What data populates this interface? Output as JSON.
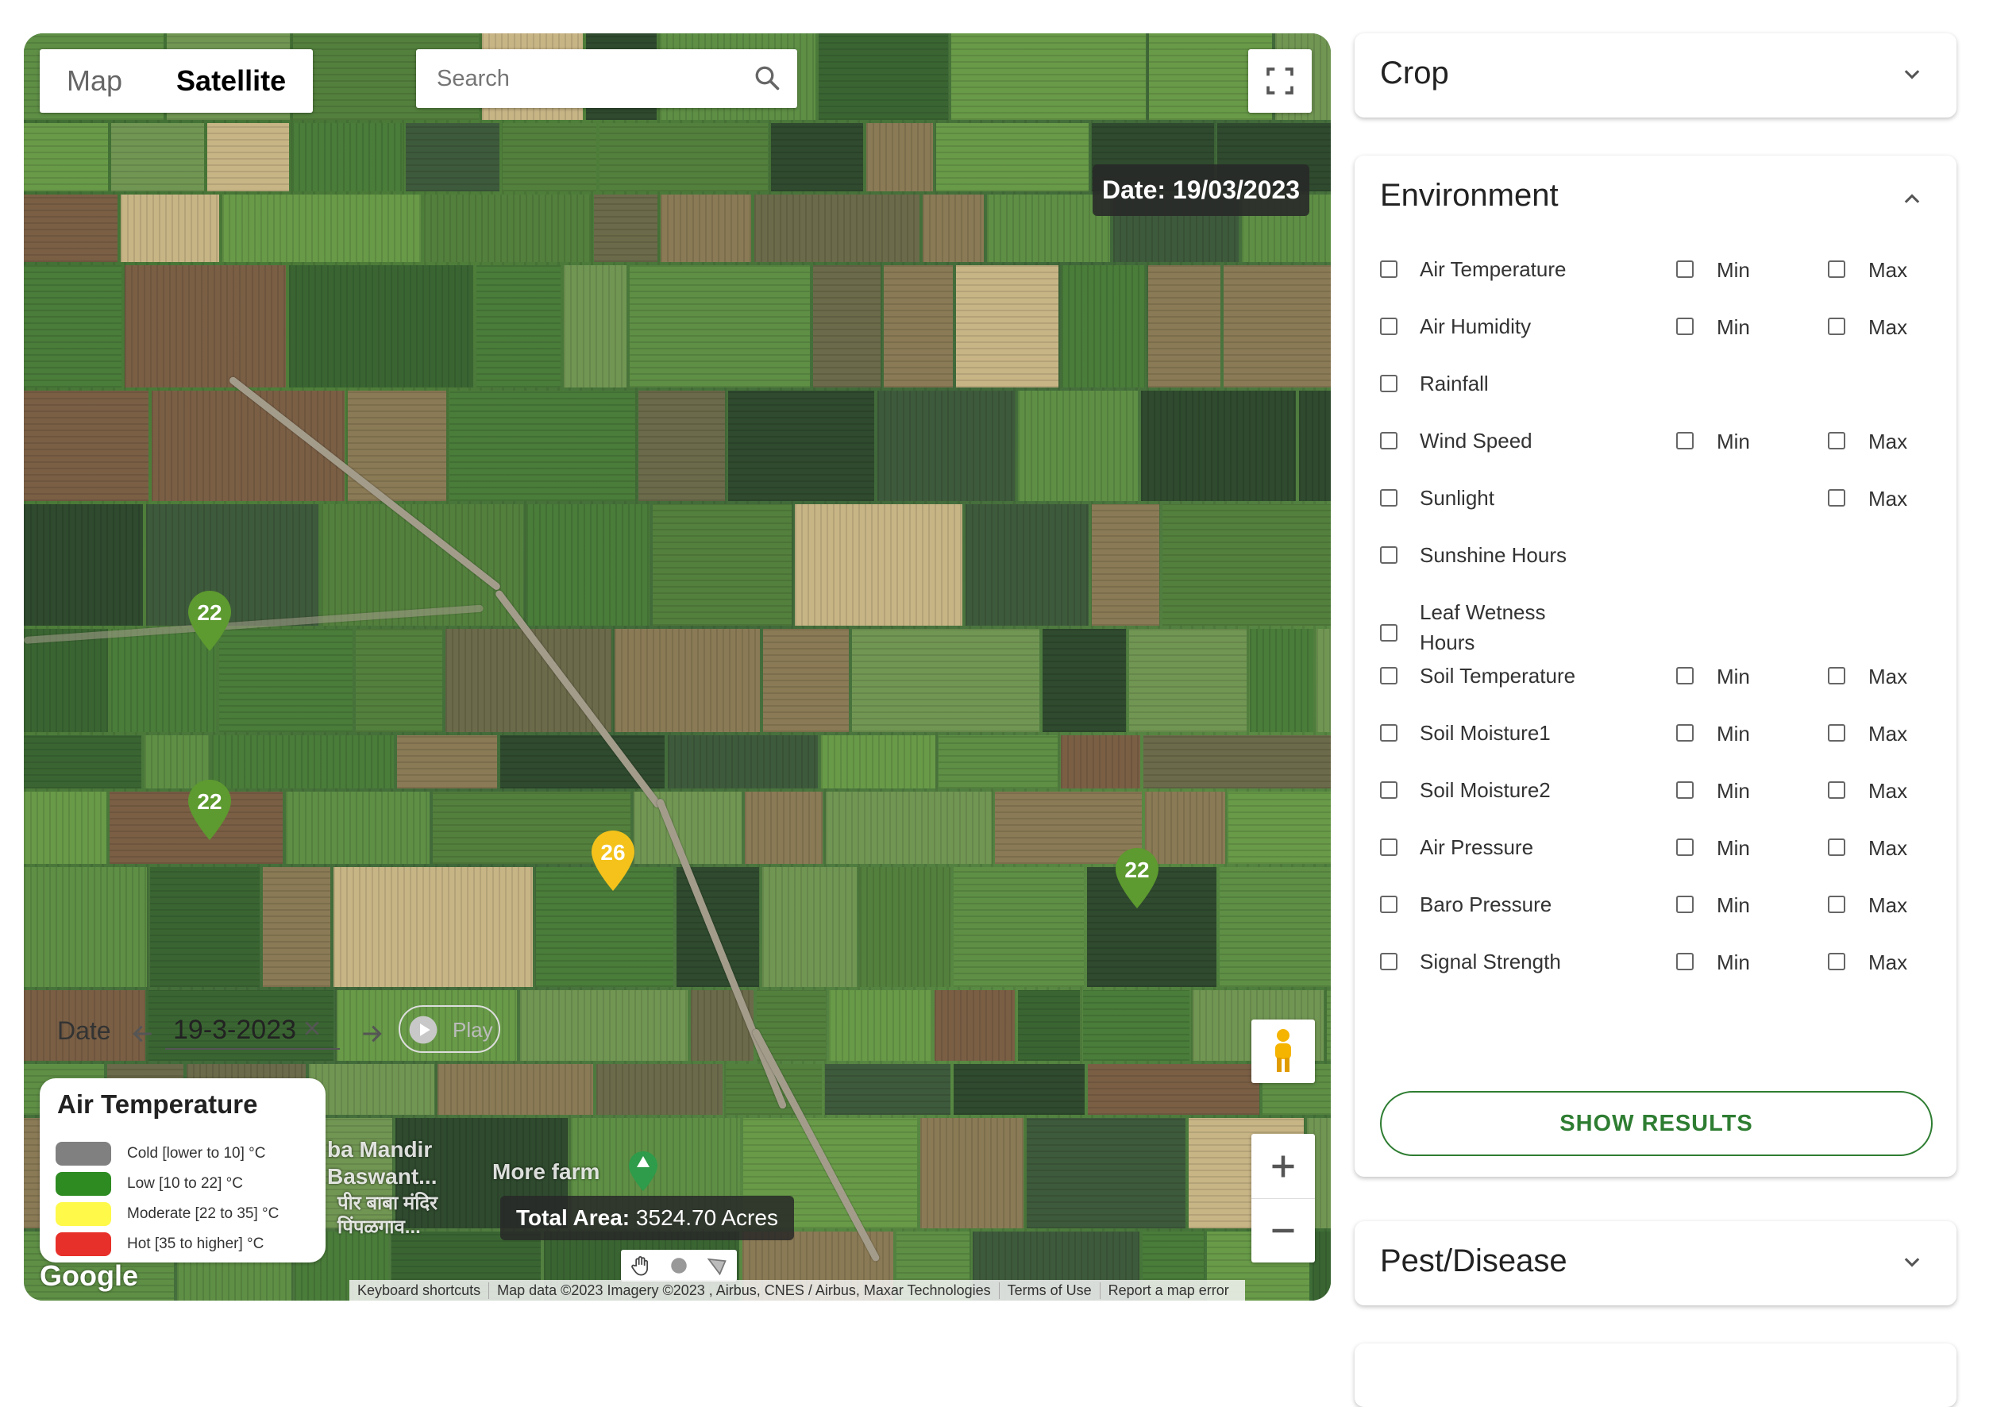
{
  "map": {
    "type_tabs": [
      "Map",
      "Satellite"
    ],
    "active_tab": "Satellite",
    "search_placeholder": "Search",
    "date_overlay": "Date: 19/03/2023",
    "markers": [
      {
        "value": "22",
        "color": "#5d9a2f"
      },
      {
        "value": "22",
        "color": "#5d9a2f"
      },
      {
        "value": "26",
        "color": "#f4c21a"
      },
      {
        "value": "22",
        "color": "#5d9a2f"
      }
    ],
    "legend": {
      "title": "Air Temperature",
      "items": [
        {
          "label": "Cold [lower to 10] °C",
          "color": "#808080"
        },
        {
          "label": "Low [10 to 22] °C",
          "color": "#2e8b22"
        },
        {
          "label": "Moderate [22 to 35] °C",
          "color": "#fff94a"
        },
        {
          "label": "Hot [35 to higher] °C",
          "color": "#e8302a"
        }
      ]
    },
    "total_area_label": "Total Area:",
    "total_area_value": "3524.70 Acres",
    "place_labels": [
      "ba Mandir",
      "Baswant...",
      "पीर बाबा मंदिर",
      "पिंपळगाव...",
      "More farm"
    ],
    "logo": "Google",
    "attribution": [
      "Keyboard shortcuts",
      "Map data ©2023 Imagery ©2023 , Airbus, CNES / Airbus, Maxar Technologies",
      "Terms of Use",
      "Report a map error"
    ]
  },
  "panel": {
    "crop": {
      "title": "Crop"
    },
    "environment": {
      "title": "Environment",
      "min_label": "Min",
      "max_label": "Max",
      "rows": [
        {
          "label": "Air Temperature",
          "min": true,
          "max": true
        },
        {
          "label": "Air Humidity",
          "min": true,
          "max": true
        },
        {
          "label": "Rainfall",
          "min": false,
          "max": false
        },
        {
          "label": "Wind Speed",
          "min": true,
          "max": true
        },
        {
          "label": "Sunlight",
          "min": false,
          "max": true
        },
        {
          "label": "Sunshine Hours",
          "min": false,
          "max": false
        },
        {
          "label": "Leaf Wetness Hours",
          "min": false,
          "max": false
        },
        {
          "label": "Soil Temperature",
          "min": true,
          "max": true
        },
        {
          "label": "Soil Moisture1",
          "min": true,
          "max": true
        },
        {
          "label": "Soil Moisture2",
          "min": true,
          "max": true
        },
        {
          "label": "Air Pressure",
          "min": true,
          "max": true
        },
        {
          "label": "Baro Pressure",
          "min": true,
          "max": true
        },
        {
          "label": "Signal Strength",
          "min": true,
          "max": true
        }
      ],
      "date_label": "Date",
      "date_value": "19-3-2023",
      "play_label": "Play",
      "show_results": "SHOW RESULTS"
    },
    "pest": {
      "title": "Pest/Disease"
    }
  }
}
